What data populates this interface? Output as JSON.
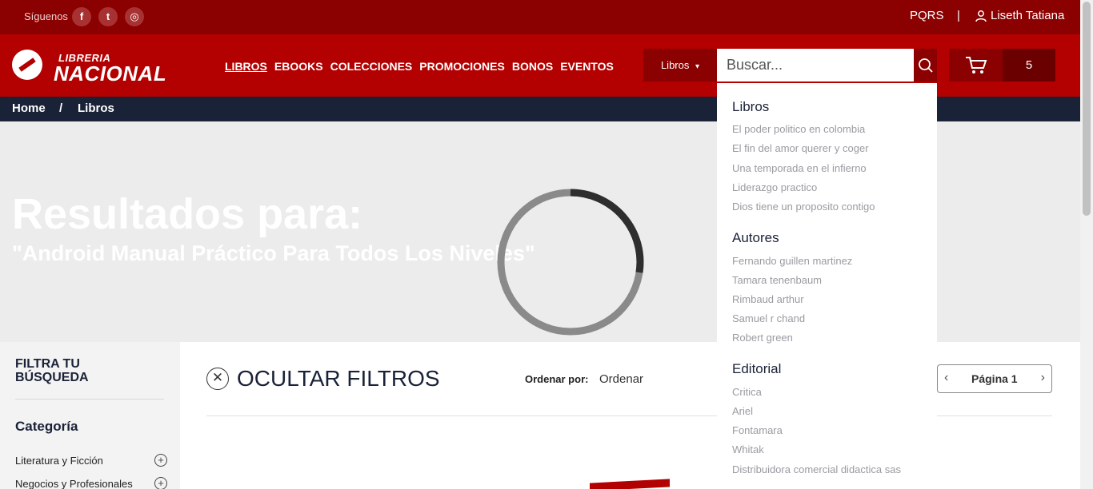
{
  "topbar": {
    "follow_label": "Síguenos",
    "social": [
      {
        "icon": "facebook-icon",
        "glyph": "f"
      },
      {
        "icon": "twitter-icon",
        "glyph": "t"
      },
      {
        "icon": "instagram-icon",
        "glyph": "◎"
      }
    ],
    "pqrs": "PQRS",
    "separator": "|",
    "user_name": "Liseth Tatiana"
  },
  "brand": {
    "line1": "LIBRERIA",
    "line2": "NACIONAL",
    "color": "#b30000",
    "dark": "#8b0000"
  },
  "nav": [
    "LIBROS",
    "EBOOKS",
    "COLECCIONES",
    "PROMOCIONES",
    "BONOS",
    "EVENTOS"
  ],
  "search": {
    "category": "Libros",
    "placeholder": "Buscar...",
    "category_caret": "▾"
  },
  "cart": {
    "count": "5"
  },
  "breadcrumb": {
    "home": "Home",
    "sep": "/",
    "current": "Libros"
  },
  "hero": {
    "title": "Resultados para:",
    "query": "\"Android Manual Práctico Para Todos Los Niveles\""
  },
  "sidebar": {
    "title_line1": "FILTRA TU",
    "title_line2": "BÚSQUEDA",
    "category_heading": "Categoría",
    "items": [
      "Literatura y Ficción",
      "Negocios y Profesionales"
    ]
  },
  "results": {
    "hide_filters": "OCULTAR FILTROS",
    "sort_label": "Ordenar por:",
    "sort_value": "Ordenar",
    "page": "Página 1"
  },
  "suggestions": {
    "books_heading": "Libros",
    "books": [
      "El poder politico en colombia",
      "El fin del amor querer y coger",
      "Una temporada en el infierno",
      "Liderazgo practico",
      "Dios tiene un proposito contigo"
    ],
    "authors_heading": "Autores",
    "authors": [
      "Fernando guillen martinez",
      "Tamara tenenbaum",
      "Rimbaud arthur",
      "Samuel r chand",
      "Robert green"
    ],
    "publishers_heading": "Editorial",
    "publishers": [
      "Critica",
      "Ariel",
      "Fontamara",
      "Whitak",
      "Distribuidora comercial didactica sas"
    ]
  }
}
